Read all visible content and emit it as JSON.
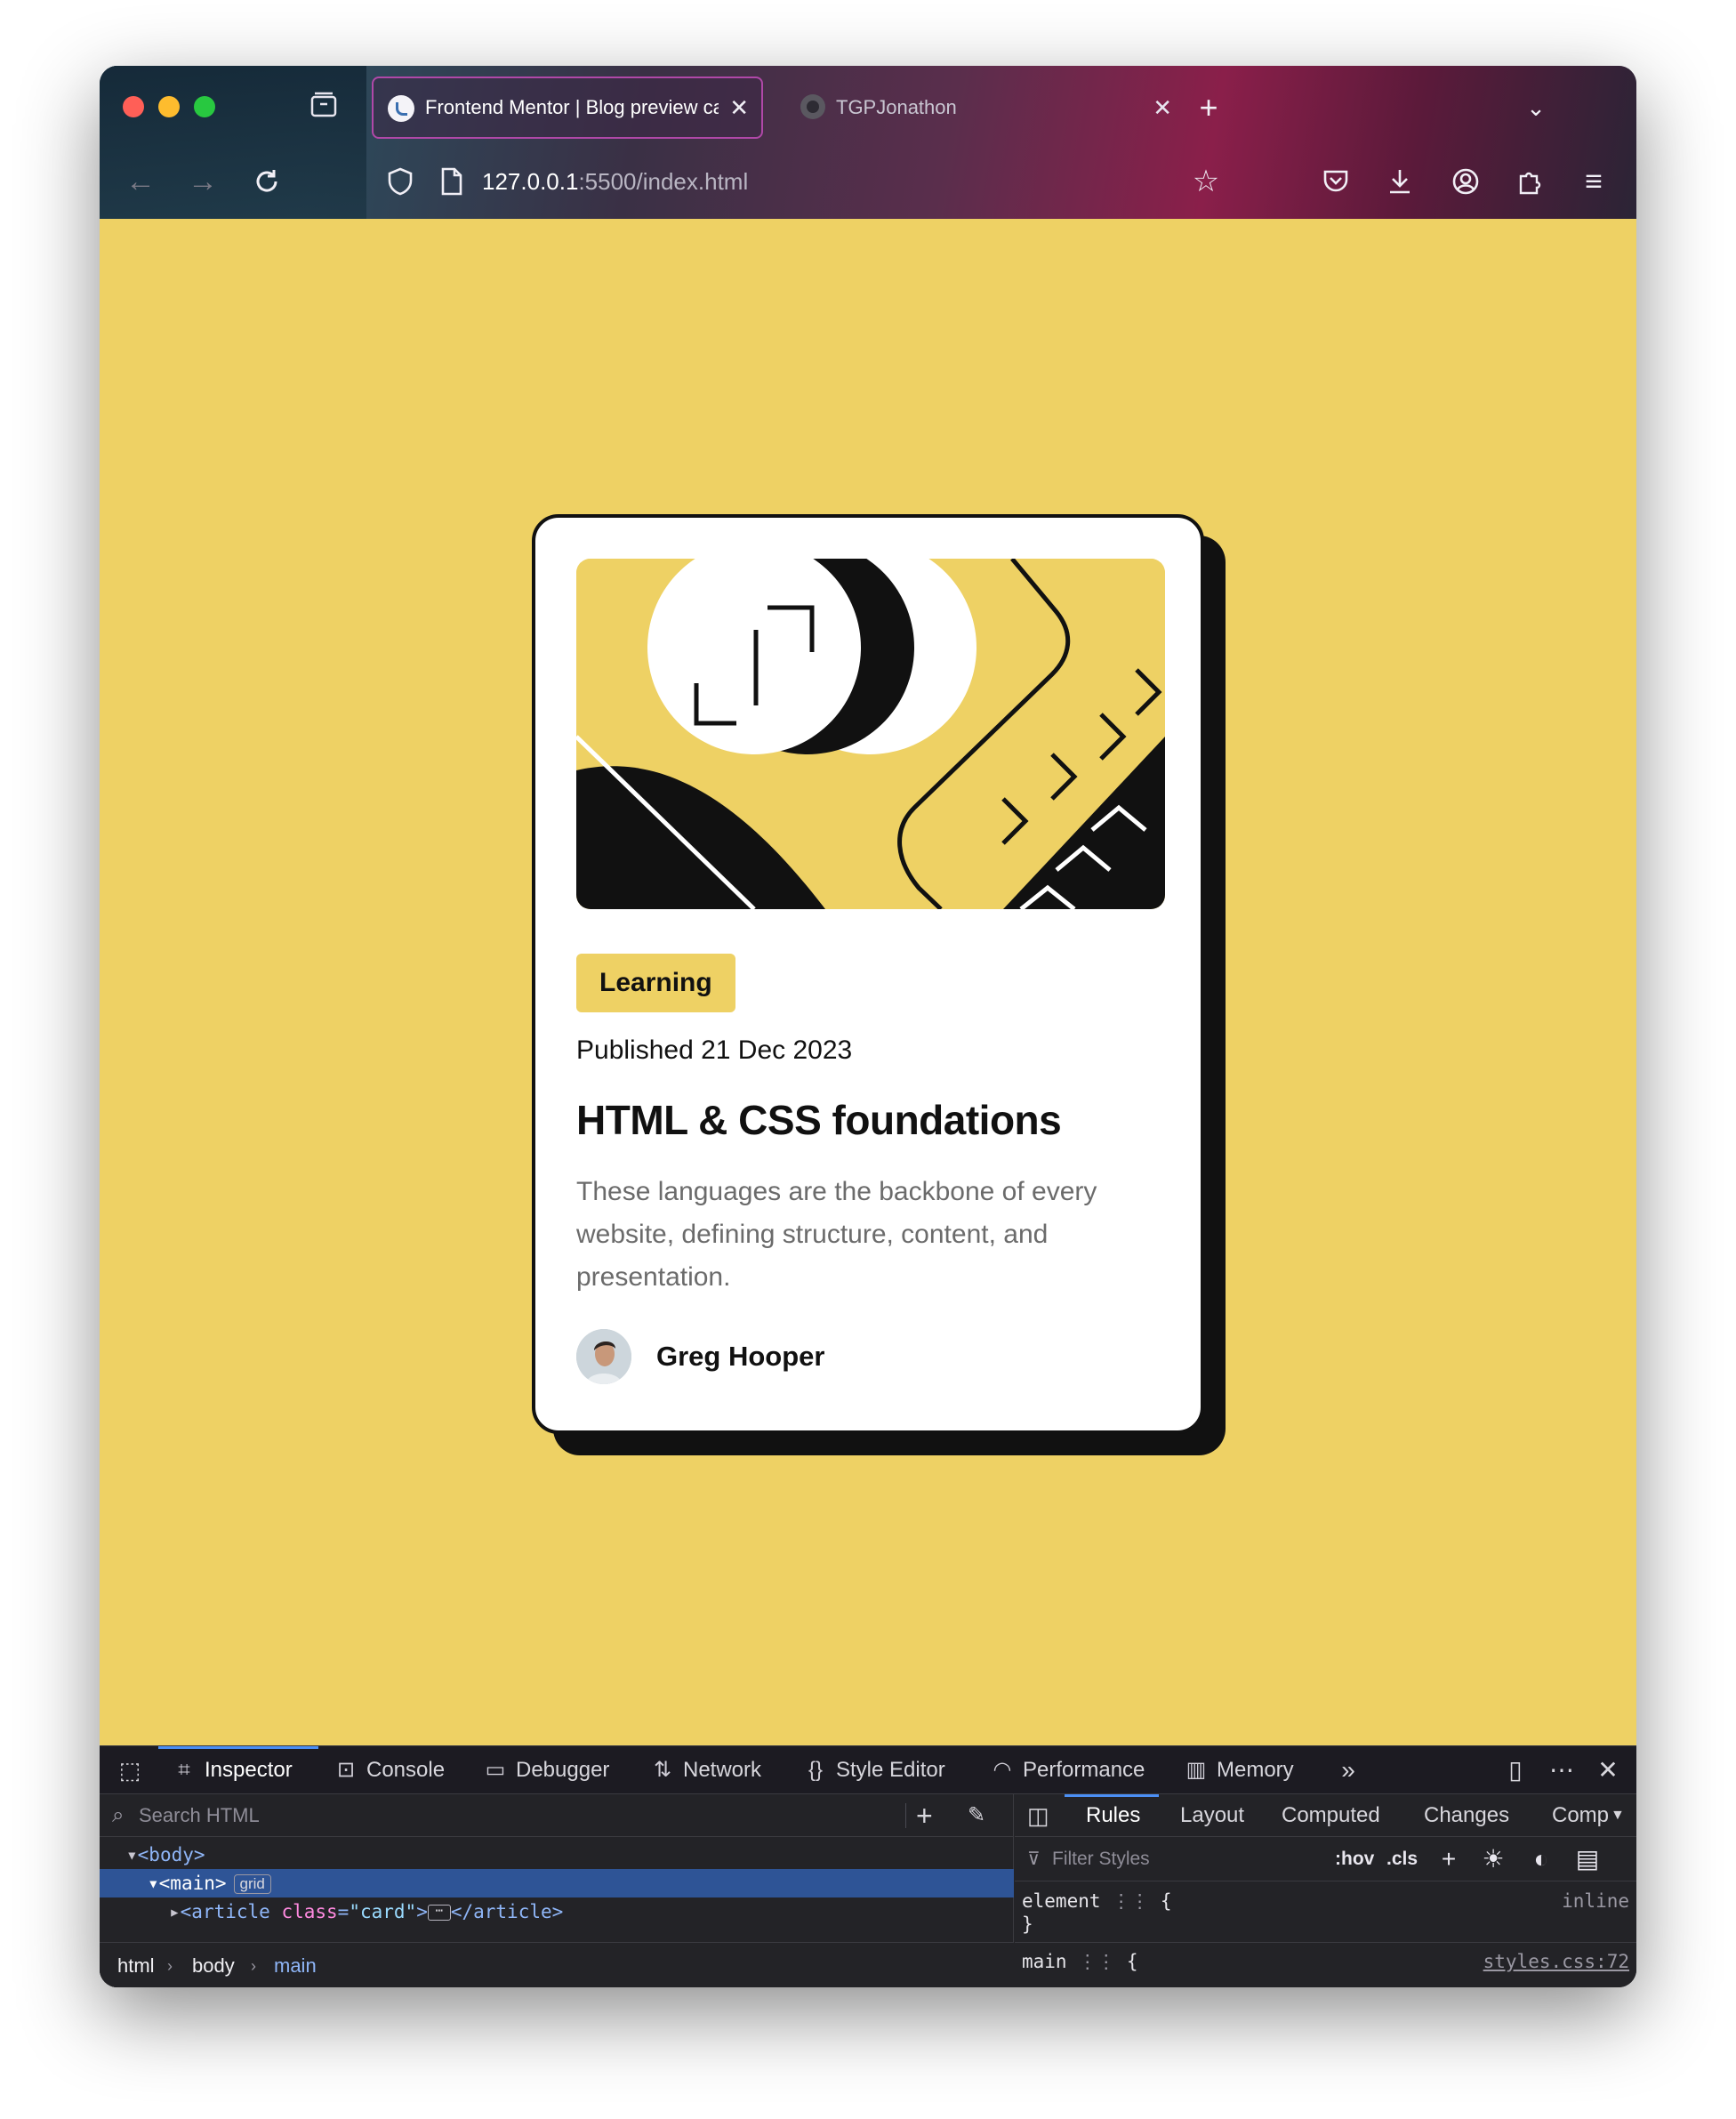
{
  "browser": {
    "tabs": [
      {
        "title": "Frontend Mentor | Blog preview card",
        "active": true
      },
      {
        "title": "TGPJonathon",
        "active": false
      }
    ],
    "url": {
      "host": "127.0.0.1",
      "rest": ":5500/index.html"
    }
  },
  "page": {
    "background": "#eed164",
    "card": {
      "category": "Learning",
      "published": "Published 21 Dec 2023",
      "title": "HTML & CSS foundations",
      "description": "These languages are the backbone of every website, defining structure, content, and presentation.",
      "author": "Greg Hooper"
    }
  },
  "devtools": {
    "tabs": [
      "Inspector",
      "Console",
      "Debugger",
      "Network",
      "Style Editor",
      "Performance",
      "Memory"
    ],
    "search_placeholder": "Search HTML",
    "tree": {
      "body": "<body>",
      "main": "<main>",
      "main_badge": "grid",
      "article_open": "<article ",
      "article_attr": "class",
      "article_val": "\"card\"",
      "article_close": "</article>"
    },
    "breadcrumbs": [
      "html",
      "body",
      "main"
    ],
    "rules_tabs": [
      "Rules",
      "Layout",
      "Computed",
      "Changes",
      "Compatibility"
    ],
    "filter_placeholder": "Filter Styles",
    "pseudo_hov": ":hov",
    "pseudo_cls": ".cls",
    "rules": {
      "element_selector": "element",
      "element_source": "inline",
      "main_selector": "main",
      "main_source": "styles.css:72",
      "brace_open": "{",
      "brace_close": "}"
    }
  }
}
